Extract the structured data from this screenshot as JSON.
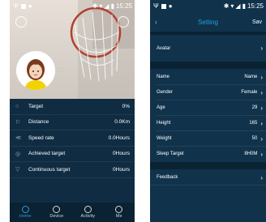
{
  "left_screen": {
    "status": {
      "time": "15:25"
    },
    "profile": {
      "username": "..."
    },
    "stats": [
      {
        "icon": "target-icon",
        "label": "Target",
        "value": "0%"
      },
      {
        "icon": "flag-icon",
        "label": "Distance",
        "value": "0.0Km"
      },
      {
        "icon": "speed-icon",
        "label": "Speed rate",
        "value": "0.0Hours"
      },
      {
        "icon": "achieved-icon",
        "label": "Achieved target",
        "value": "0Hours"
      },
      {
        "icon": "continuous-icon",
        "label": "Continuous target",
        "value": "0Hours"
      }
    ],
    "tabs": [
      {
        "label": "Home",
        "active": true
      },
      {
        "label": "Device",
        "active": false
      },
      {
        "label": "Activity",
        "active": false
      },
      {
        "label": "Me",
        "active": false
      }
    ]
  },
  "right_screen": {
    "status": {
      "time": "15:25"
    },
    "header": {
      "title": "Setting",
      "save": "Sav"
    },
    "avatar": {
      "label": "Avatar"
    },
    "items": [
      {
        "label": "Name",
        "value": "Name"
      },
      {
        "label": "Gender",
        "value": "Female"
      },
      {
        "label": "Age",
        "value": "29"
      },
      {
        "label": "Height",
        "value": "165"
      },
      {
        "label": "Weight",
        "value": "50"
      },
      {
        "label": "Sleep Target",
        "value": "8H0M"
      }
    ],
    "feedback": {
      "label": "Feedback"
    }
  },
  "colors": {
    "accent": "#1ea2e0",
    "background": "#10324b"
  }
}
